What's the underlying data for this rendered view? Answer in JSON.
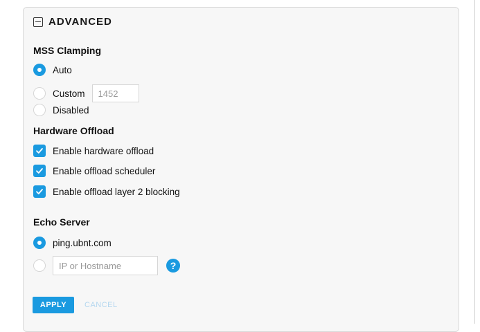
{
  "section": {
    "title": "ADVANCED"
  },
  "mss_clamping": {
    "label": "MSS Clamping",
    "options": [
      {
        "label": "Auto",
        "selected": true
      },
      {
        "label": "Custom",
        "selected": false
      },
      {
        "label": "Disabled",
        "selected": false
      }
    ],
    "custom_placeholder": "1452"
  },
  "hardware_offload": {
    "label": "Hardware Offload",
    "options": [
      {
        "label": "Enable hardware offload",
        "checked": true
      },
      {
        "label": "Enable offload scheduler",
        "checked": true
      },
      {
        "label": "Enable offload layer 2 blocking",
        "checked": true
      }
    ]
  },
  "echo_server": {
    "label": "Echo Server",
    "options": [
      {
        "label": "ping.ubnt.com",
        "selected": true
      },
      {
        "label": "",
        "selected": false
      }
    ],
    "host_placeholder": "IP or Hostname",
    "help_glyph": "?"
  },
  "actions": {
    "apply_label": "APPLY",
    "cancel_label": "CANCEL"
  },
  "colors": {
    "accent": "#1a9ae0",
    "panel_bg": "#f7f7f7",
    "cancel_disabled": "#b4d7ef"
  }
}
